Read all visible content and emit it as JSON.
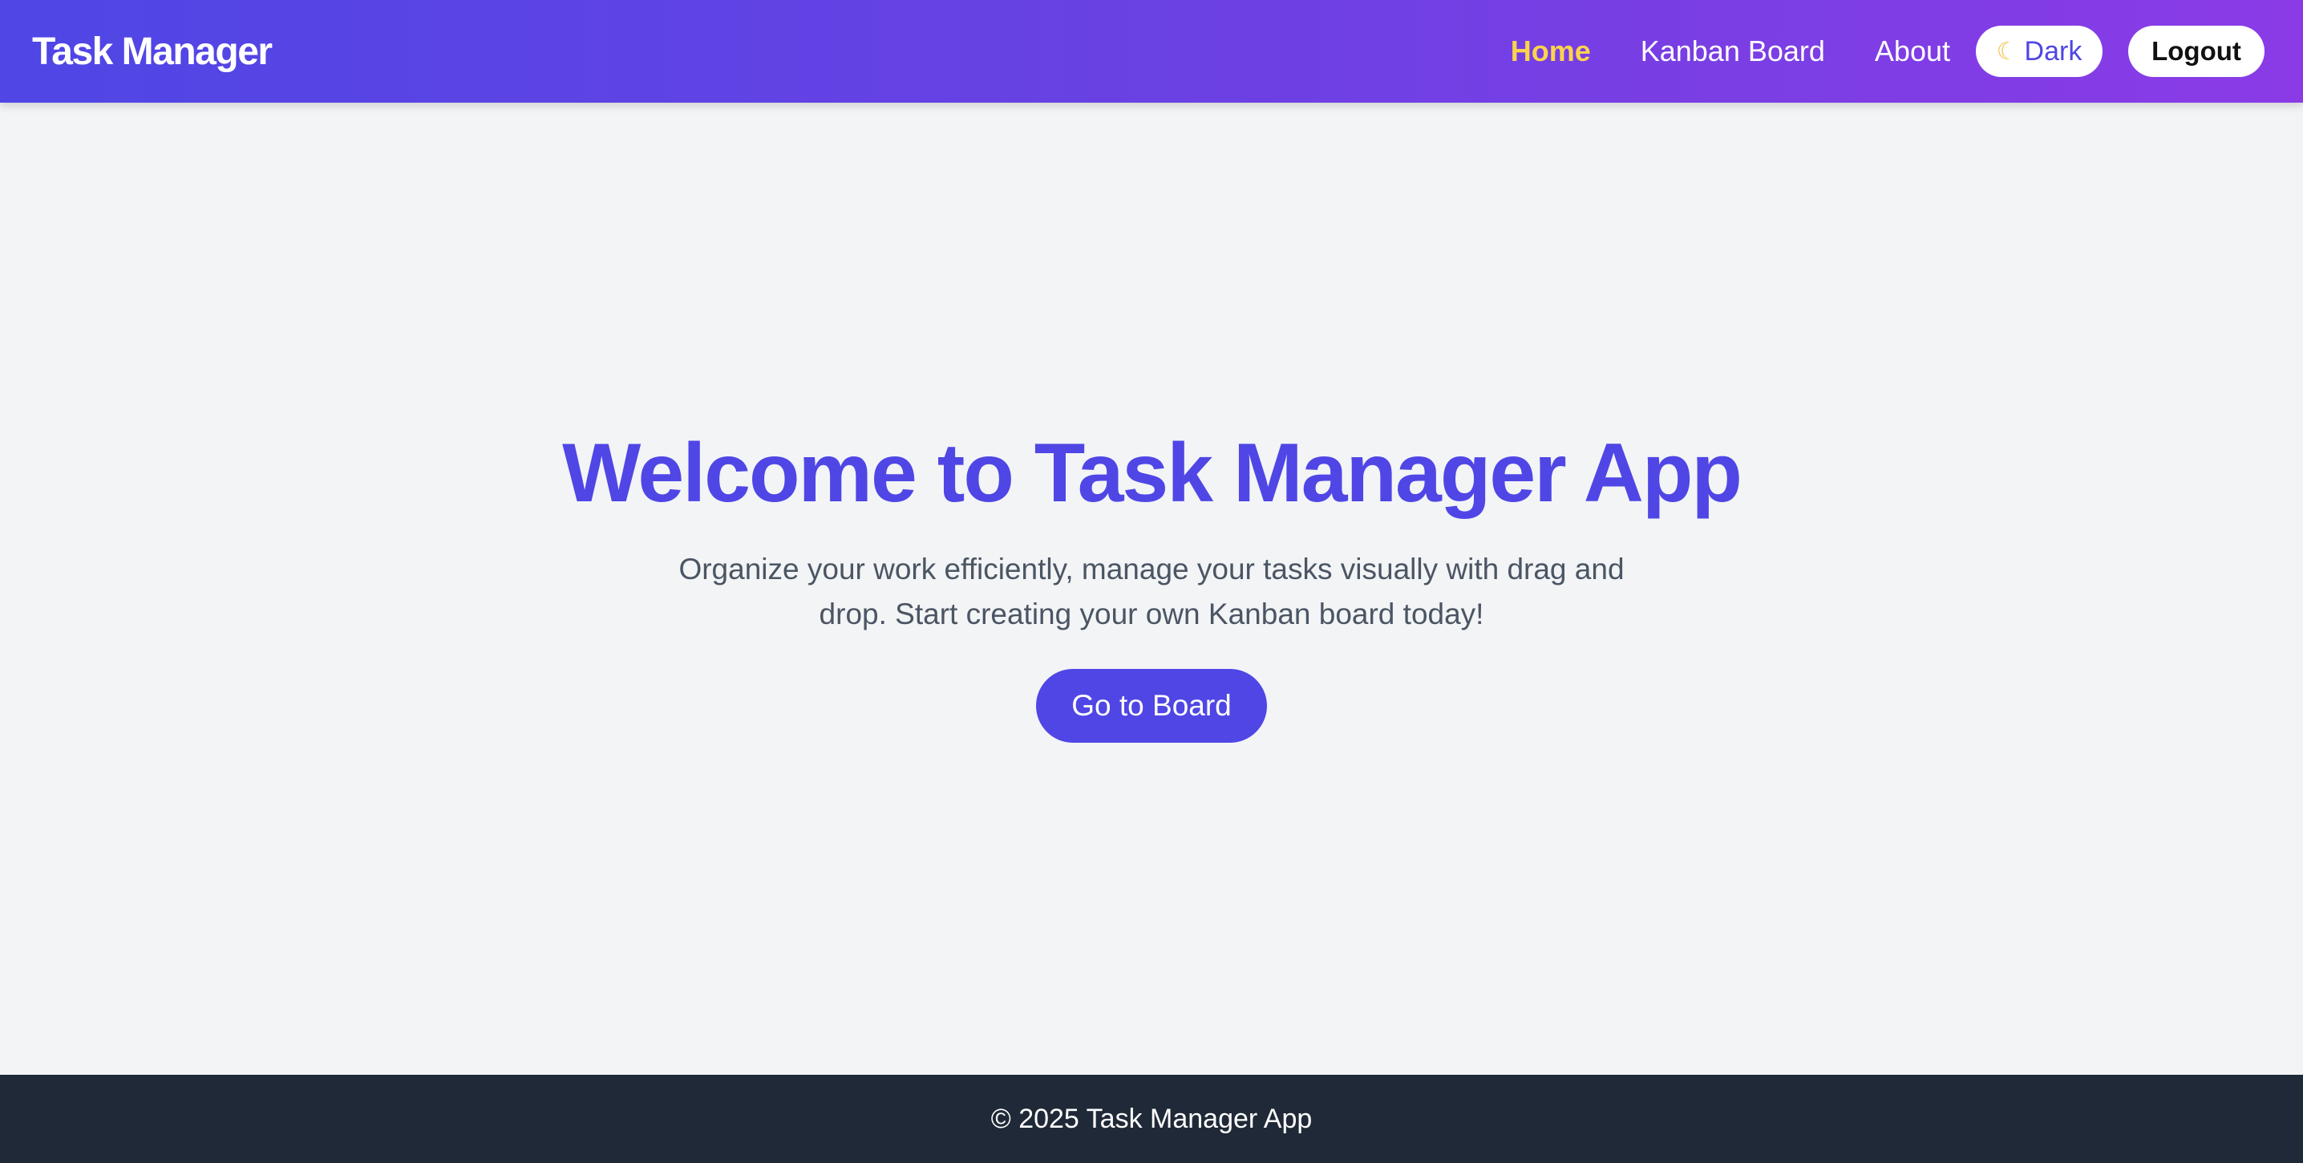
{
  "navbar": {
    "brand": "Task Manager",
    "links": [
      {
        "label": "Home",
        "active": true
      },
      {
        "label": "Kanban Board",
        "active": false
      },
      {
        "label": "About",
        "active": false
      }
    ],
    "theme_toggle": {
      "icon": "moon-icon",
      "label": "Dark"
    },
    "logout_label": "Logout",
    "gradient": [
      "#4f46e5",
      "#8a3be6"
    ],
    "active_link_color": "#fcd34d"
  },
  "hero": {
    "title": "Welcome to Task Manager App",
    "subtitle": "Organize your work efficiently, manage your tasks visually with drag and drop. Start creating your own Kanban board today!",
    "cta_label": "Go to Board",
    "accent_color": "#4f46e5"
  },
  "footer": {
    "text": "© 2025 Task Manager App",
    "background": "#1f2937"
  }
}
